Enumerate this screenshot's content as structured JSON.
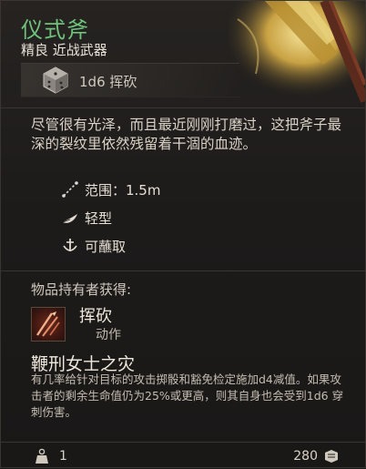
{
  "item": {
    "name": "仪式斧",
    "subtitle": "精良 近战武器",
    "damage": "1d6 挥砍",
    "description": "尽管很有光泽，而且最近刚刚打磨过，这把斧子最深的裂纹里依然残留着干涸的血迹。",
    "properties": [
      {
        "icon": "range-icon",
        "label": "范围：1.5m"
      },
      {
        "icon": "feather-icon",
        "label": "轻型"
      },
      {
        "icon": "dip-icon",
        "label": "可蘸取"
      }
    ],
    "grants_label": "物品持有者获得:",
    "ability": {
      "name": "挥砍",
      "type": "动作"
    },
    "passive": {
      "title": "鞭刑女士之灾",
      "text": "有几率给针对目标的攻击掷骰和豁免检定施加d4减值。如果攻击者的剩余生命值仍为25%或更高，则其自身也会受到1d6 穿刺伤害。"
    },
    "weight": "1",
    "value": "280"
  },
  "colors": {
    "name": "#6fc27c",
    "background": "#1d1b1a"
  }
}
